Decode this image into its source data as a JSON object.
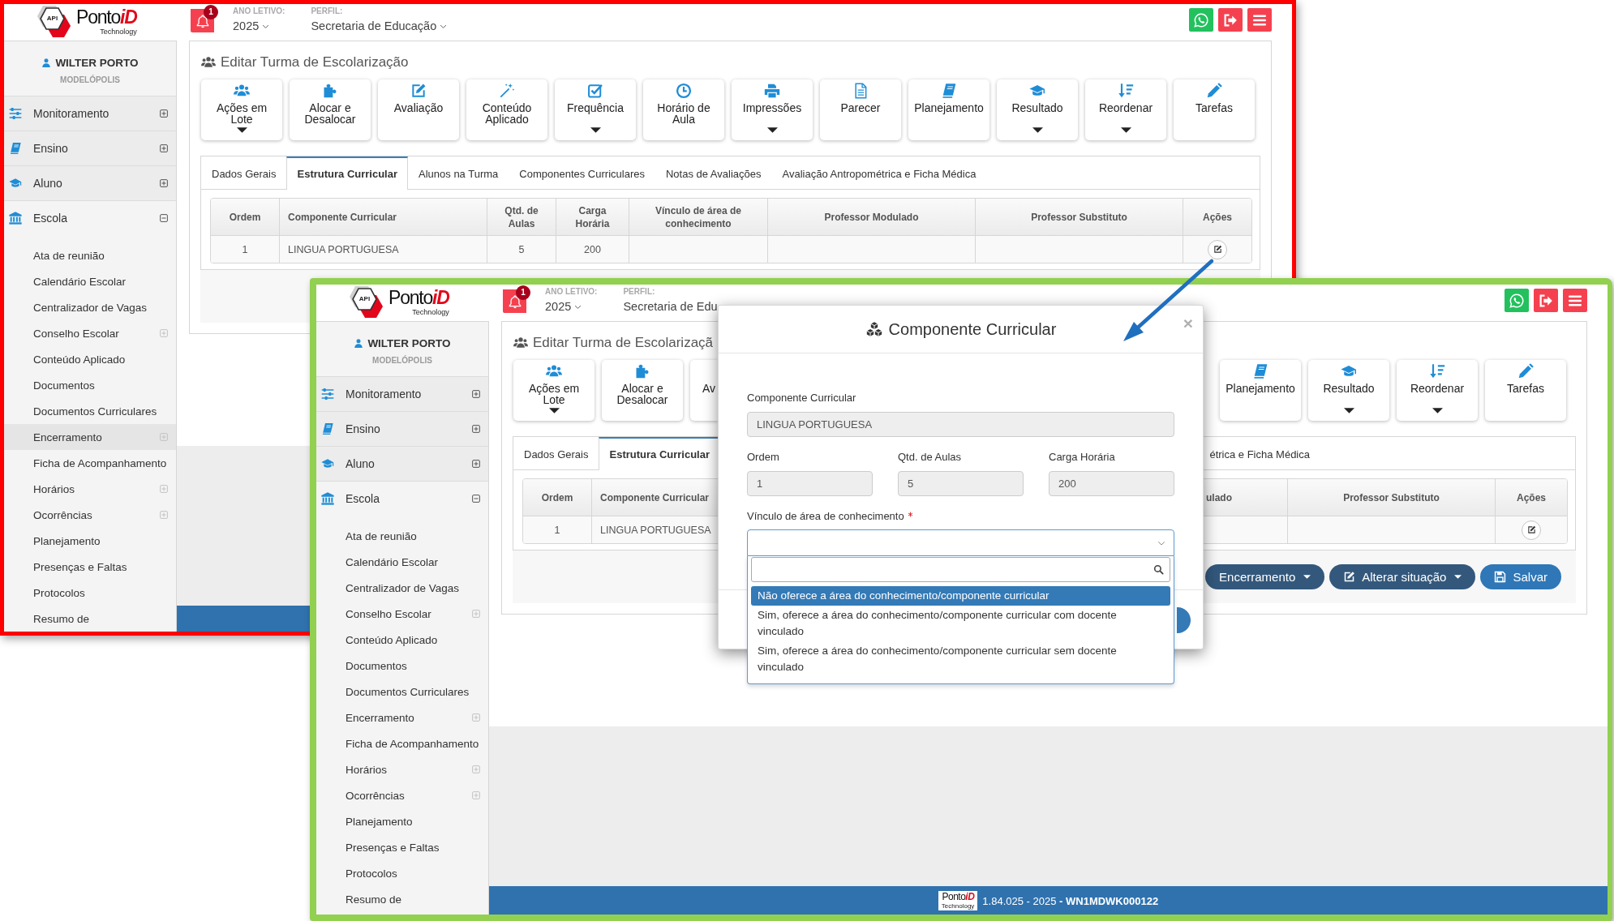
{
  "windows": [
    {
      "color": "#ff0000",
      "header": {
        "logo": {
          "mark": "API",
          "name": "Ponto",
          "name_accent": "iD",
          "tagline": "Technology"
        },
        "notification_count": "1",
        "year": {
          "label": "ANO LETIVO:",
          "value": "2025"
        },
        "profile": {
          "label": "PERFIL:",
          "value": "Secretaria de Educação",
          "clipped": false
        }
      },
      "sidebar": {
        "user": "WILTER PORTO",
        "organization": "MODELÓPOLIS",
        "menu": [
          {
            "label": "Monitoramento",
            "expanded": false
          },
          {
            "label": "Ensino",
            "expanded": false
          },
          {
            "label": "Aluno",
            "expanded": false
          },
          {
            "label": "Escola",
            "expanded": true,
            "children": [
              {
                "label": "Ata de reunião",
                "has_submenu": false,
                "highlighted": false
              },
              {
                "label": "Calendário Escolar",
                "has_submenu": false,
                "highlighted": false
              },
              {
                "label": "Centralizador de Vagas",
                "has_submenu": false,
                "highlighted": false
              },
              {
                "label": "Conselho Escolar",
                "has_submenu": true,
                "highlighted": false
              },
              {
                "label": "Conteúdo Aplicado",
                "has_submenu": false,
                "highlighted": false
              },
              {
                "label": "Documentos",
                "has_submenu": false,
                "highlighted": false
              },
              {
                "label": "Documentos Curriculares",
                "has_submenu": false,
                "highlighted": false
              },
              {
                "label": "Encerramento",
                "has_submenu": true,
                "highlighted": true
              },
              {
                "label": "Ficha de Acompanhamento",
                "has_submenu": false,
                "highlighted": false
              },
              {
                "label": "Horários",
                "has_submenu": true,
                "highlighted": false
              },
              {
                "label": "Ocorrências",
                "has_submenu": true,
                "highlighted": false
              },
              {
                "label": "Planejamento",
                "has_submenu": false,
                "highlighted": false
              },
              {
                "label": "Presenças e Faltas",
                "has_submenu": false,
                "highlighted": false
              },
              {
                "label": "Protocolos",
                "has_submenu": false,
                "highlighted": false
              },
              {
                "label": "Resumo de",
                "has_submenu": false,
                "highlighted": false
              }
            ]
          }
        ]
      },
      "page": {
        "title": "Editar Turma de Escolarização",
        "toolbar_groups": [
          {
            "buttons": [
              {
                "label": "Ações em Lote",
                "dropdown": true,
                "clipped": false
              },
              {
                "label": "Alocar e Desalocar",
                "dropdown": false,
                "clipped": false
              },
              {
                "label": "Avaliação",
                "dropdown": false,
                "clipped": false
              },
              {
                "label": "Conteúdo Aplicado",
                "dropdown": false,
                "clipped": false
              },
              {
                "label": "Frequência",
                "dropdown": true,
                "clipped": false
              },
              {
                "label": "Horário de Aula",
                "dropdown": false,
                "clipped": false
              },
              {
                "label": "Impressões",
                "dropdown": true,
                "clipped": false
              },
              {
                "label": "Parecer",
                "dropdown": false,
                "clipped": false
              },
              {
                "label": "Planejamento",
                "dropdown": false,
                "clipped": false
              },
              {
                "label": "Resultado",
                "dropdown": true,
                "clipped": false
              },
              {
                "label": "Reordenar",
                "dropdown": true,
                "clipped": false
              },
              {
                "label": "Tarefas",
                "dropdown": false,
                "clipped": false
              }
            ]
          }
        ],
        "tabs": [
          {
            "label": "Dados Gerais",
            "selected": false,
            "clipped": false
          },
          {
            "label": "Estrutura Curricular",
            "selected": true,
            "clipped": false
          },
          {
            "label": "Alunos na Turma",
            "selected": false,
            "clipped": false
          },
          {
            "label": "Componentes Curriculares",
            "selected": false,
            "clipped": false
          },
          {
            "label": "Notas de Avaliações",
            "selected": false,
            "clipped": false
          },
          {
            "label": "Avaliação Antropométrica e Ficha Médica",
            "selected": false,
            "clipped": false
          }
        ],
        "table": {
          "columns": [
            {
              "label": "Ordem",
              "clipped": false
            },
            {
              "label": "Componente Curricular",
              "clipped": false
            },
            {
              "label": "Qtd. de Aulas",
              "clipped": false
            },
            {
              "label": "Carga Horária",
              "clipped": false
            },
            {
              "label": "Vínculo de área de conhecimento",
              "clipped": false
            },
            {
              "label": "Professor Modulado",
              "clipped": false
            },
            {
              "label": "Professor Substituto",
              "clipped": false
            },
            {
              "label": "Ações",
              "clipped": false
            }
          ],
          "rows": [
            {
              "cells": [
                "1",
                "LINGUA PORTUGUESA",
                "5",
                "200",
                null,
                null,
                null
              ]
            }
          ]
        }
      }
    },
    {
      "color": "#92d050",
      "header": {
        "logo": {
          "mark": "API",
          "name": "Ponto",
          "name_accent": "iD",
          "tagline": "Technology"
        },
        "notification_count": "1",
        "year": {
          "label": "ANO LETIVO:",
          "value": "2025"
        },
        "profile": {
          "label": "PERFIL:",
          "value": "Secretaria de Edu",
          "clipped": true
        }
      },
      "sidebar": {
        "user": "WILTER PORTO",
        "organization": "MODELÓPOLIS",
        "menu": [
          {
            "label": "Monitoramento",
            "expanded": false
          },
          {
            "label": "Ensino",
            "expanded": false
          },
          {
            "label": "Aluno",
            "expanded": false
          },
          {
            "label": "Escola",
            "expanded": true,
            "children": [
              {
                "label": "Ata de reunião",
                "has_submenu": false,
                "highlighted": false
              },
              {
                "label": "Calendário Escolar",
                "has_submenu": false,
                "highlighted": false
              },
              {
                "label": "Centralizador de Vagas",
                "has_submenu": false,
                "highlighted": false
              },
              {
                "label": "Conselho Escolar",
                "has_submenu": true,
                "highlighted": false
              },
              {
                "label": "Conteúdo Aplicado",
                "has_submenu": false,
                "highlighted": false
              },
              {
                "label": "Documentos",
                "has_submenu": false,
                "highlighted": false
              },
              {
                "label": "Documentos Curriculares",
                "has_submenu": false,
                "highlighted": false
              },
              {
                "label": "Encerramento",
                "has_submenu": true,
                "highlighted": false
              },
              {
                "label": "Ficha de Acompanhamento",
                "has_submenu": false,
                "highlighted": false
              },
              {
                "label": "Horários",
                "has_submenu": true,
                "highlighted": false
              },
              {
                "label": "Ocorrências",
                "has_submenu": true,
                "highlighted": false
              },
              {
                "label": "Planejamento",
                "has_submenu": false,
                "highlighted": false
              },
              {
                "label": "Presenças e Faltas",
                "has_submenu": false,
                "highlighted": false
              },
              {
                "label": "Protocolos",
                "has_submenu": false,
                "highlighted": false
              },
              {
                "label": "Resumo de",
                "has_submenu": false,
                "highlighted": false
              }
            ]
          }
        ]
      },
      "page": {
        "title": "Editar Turma de Escolarizaçã",
        "toolbar_groups": [
          {
            "buttons": [
              {
                "label": "Ações em Lote",
                "dropdown": true,
                "clipped": false
              },
              {
                "label": "Alocar e Desalocar",
                "dropdown": false,
                "clipped": false
              },
              {
                "label": "Av",
                "dropdown": false,
                "clipped": true
              }
            ]
          },
          {
            "buttons": [
              {
                "label": "Planejamento",
                "dropdown": false,
                "clipped": false
              },
              {
                "label": "Resultado",
                "dropdown": true,
                "clipped": false
              },
              {
                "label": "Reordenar",
                "dropdown": true,
                "clipped": false
              },
              {
                "label": "Tarefas",
                "dropdown": false,
                "clipped": false
              }
            ]
          }
        ],
        "tabs": [
          {
            "label": "Dados Gerais",
            "selected": false,
            "clipped": false
          },
          {
            "label": "Estrutura Curricular",
            "selected": true,
            "clipped": false
          },
          {
            "label": "étrica e Ficha Médica",
            "selected": false,
            "clipped": true
          }
        ],
        "table": {
          "columns": [
            {
              "label": "Ordem",
              "clipped": false
            },
            {
              "label": "Componente Curricular",
              "clipped": false
            },
            null,
            null,
            null,
            {
              "label": "ulado",
              "clipped": true
            },
            {
              "label": "Professor Substituto",
              "clipped": false
            },
            {
              "label": "Ações",
              "clipped": false
            }
          ],
          "rows": [
            {
              "cells": [
                "1",
                "LINGUA PORTUGUESA",
                null,
                null,
                null,
                null,
                null
              ]
            }
          ]
        },
        "actions": [
          {
            "label": "Encerramento",
            "dropdown": true,
            "kind": "secondary"
          },
          {
            "label": "Alterar situação",
            "dropdown": true,
            "kind": "secondary"
          },
          {
            "label": "Salvar",
            "dropdown": false,
            "kind": "primary"
          }
        ]
      },
      "footer": {
        "logo": {
          "name": "Ponto",
          "name_accent": "iD",
          "tagline": "Technology"
        },
        "version": "1.84.025 - 2025 **- WN1MDWK000122**"
      },
      "modal": {
        "title": "Componente Curricular",
        "close": "×",
        "fields": [
          {
            "label": "Componente Curricular",
            "value": "LINGUA PORTUGUESA",
            "disabled": true
          },
          {
            "label": "Ordem",
            "value": "1",
            "disabled": true
          },
          {
            "label": "Qtd. de Aulas",
            "value": "5",
            "disabled": true
          },
          {
            "label": "Carga Horária",
            "value": "200",
            "disabled": true
          }
        ],
        "select": {
          "label": "Vínculo de área de conhecimento",
          "required": true,
          "open": true,
          "options": [
            {
              "label": "Não oferece a área do conhecimento/componente curricular",
              "selected": true
            },
            {
              "label": "Sim, oferece a área do conhecimento/componente curricular com docente vinculado",
              "selected": false
            },
            {
              "label": "Sim, oferece a área do conhecimento/componente curricular sem docente vinculado",
              "selected": false
            }
          ]
        }
      }
    }
  ]
}
